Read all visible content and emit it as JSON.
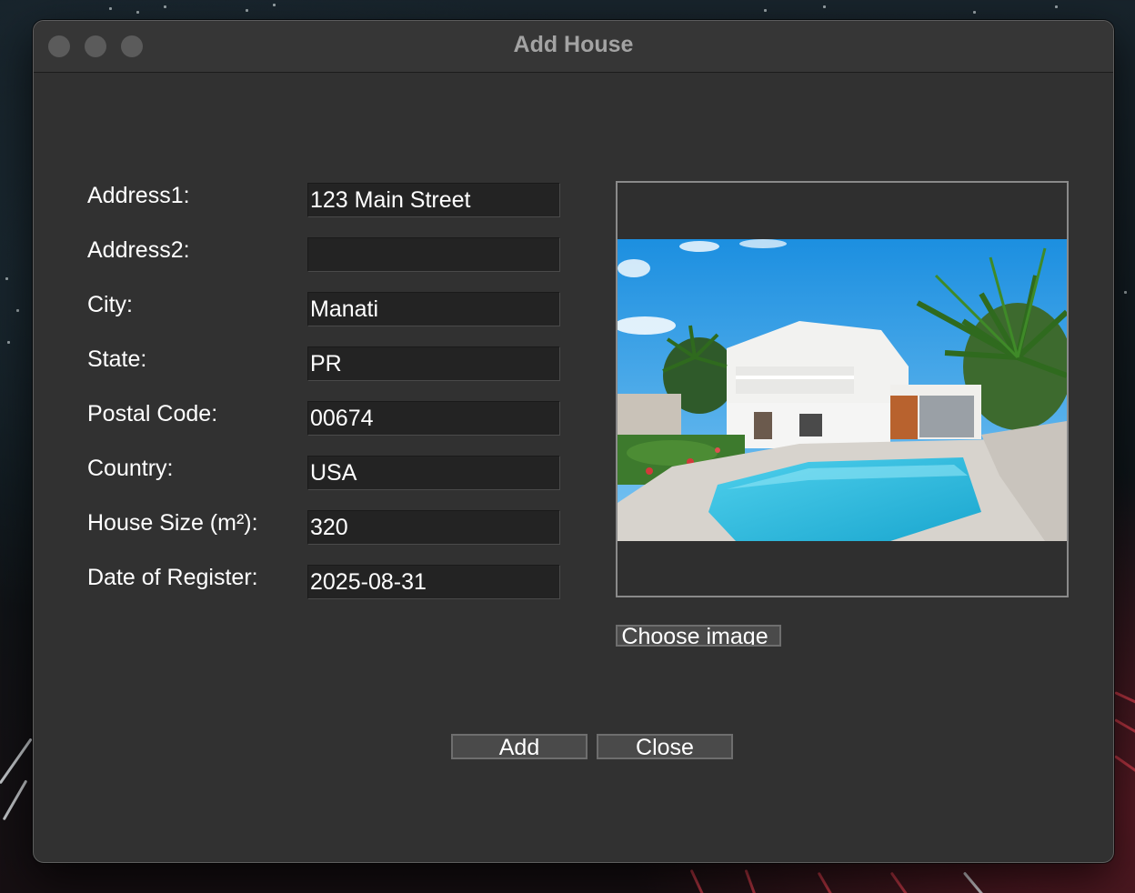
{
  "window": {
    "title": "Add House"
  },
  "form": {
    "fields": [
      {
        "label": "Address1:",
        "value": "123 Main Street"
      },
      {
        "label": "Address2:",
        "value": ""
      },
      {
        "label": "City:",
        "value": "Manati"
      },
      {
        "label": "State:",
        "value": "PR"
      },
      {
        "label": "Postal Code:",
        "value": "00674"
      },
      {
        "label": "Country:",
        "value": "USA"
      },
      {
        "label": "House Size (m²):",
        "value": "320"
      },
      {
        "label": "Date of Register:",
        "value": "2025-08-31"
      }
    ]
  },
  "image_panel": {
    "choose_label": "Choose image"
  },
  "actions": {
    "add_label": "Add",
    "close_label": "Close"
  },
  "colors": {
    "window_bg": "#313131",
    "field_bg": "#232323",
    "button_bg": "#4a4a4a",
    "text": "#ffffff",
    "title_text": "#a3a3a3"
  }
}
